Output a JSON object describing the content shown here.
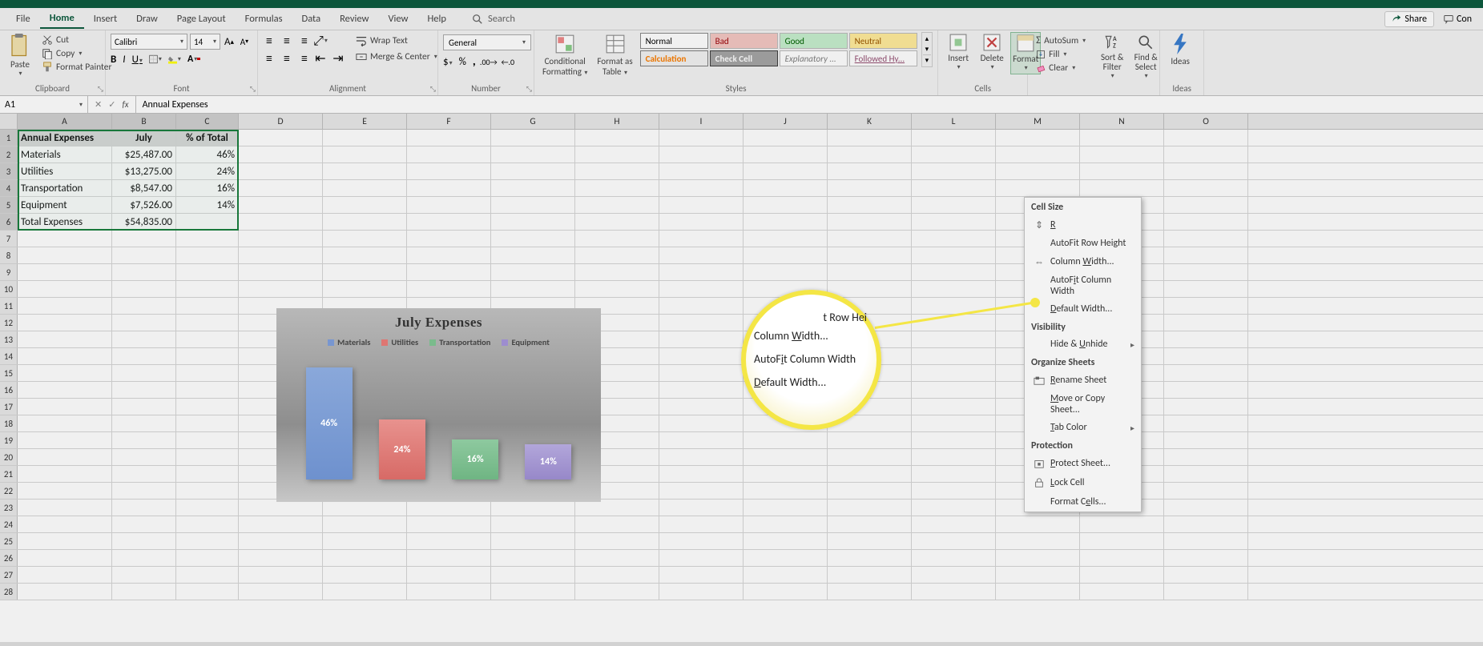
{
  "tabs": {
    "file": "File",
    "home": "Home",
    "insert": "Insert",
    "draw": "Draw",
    "pageLayout": "Page Layout",
    "formulas": "Formulas",
    "data": "Data",
    "review": "Review",
    "view": "View",
    "help": "Help",
    "search": "Search",
    "share": "Share",
    "comments": "Con"
  },
  "clipboard": {
    "paste": "Paste",
    "cut": "Cut",
    "copy": "Copy",
    "formatPainter": "Format Painter",
    "label": "Clipboard"
  },
  "font": {
    "name": "Calibri",
    "size": "14",
    "bold": "B",
    "italic": "I",
    "underline": "U",
    "label": "Font"
  },
  "alignment": {
    "wrap": "Wrap Text",
    "merge": "Merge & Center",
    "label": "Alignment"
  },
  "number": {
    "format": "General",
    "label": "Number"
  },
  "condfmt": {
    "label1": "Conditional",
    "label2": "Formatting",
    "tableLabel1": "Format as",
    "tableLabel2": "Table"
  },
  "styles": {
    "normal": "Normal",
    "bad": "Bad",
    "good": "Good",
    "neutral": "Neutral",
    "calc": "Calculation",
    "check": "Check Cell",
    "exp": "Explanatory ...",
    "follow": "Followed Hy...",
    "label": "Styles"
  },
  "cells": {
    "insert": "Insert",
    "delete": "Delete",
    "format": "Format",
    "label": "Cells"
  },
  "editing": {
    "autosum": "AutoSum",
    "fill": "Fill",
    "clear": "Clear",
    "sort": "Sort & Filter",
    "find": "Find & Select"
  },
  "ideas": {
    "label": "Ideas",
    "group": "Ideas"
  },
  "nameBox": "A1",
  "formula": "Annual Expenses",
  "columns": [
    "A",
    "B",
    "C",
    "D",
    "E",
    "F",
    "G",
    "H",
    "I",
    "J",
    "K",
    "L",
    "M",
    "N",
    "O"
  ],
  "data": {
    "headers": [
      "Annual Expenses",
      "July",
      "% of Total"
    ],
    "rows": [
      [
        "Materials",
        "$25,487.00",
        "46%"
      ],
      [
        "Utilities",
        "$13,275.00",
        "24%"
      ],
      [
        "Transportation",
        "$8,547.00",
        "16%"
      ],
      [
        "Equipment",
        "$7,526.00",
        "14%"
      ],
      [
        "Total Expenses",
        "$54,835.00",
        ""
      ]
    ]
  },
  "chart_data": {
    "type": "bar",
    "title": "July Expenses",
    "categories": [
      "Materials",
      "Utilities",
      "Transportation",
      "Equipment"
    ],
    "values": [
      46,
      24,
      16,
      14
    ],
    "value_labels": [
      "46%",
      "24%",
      "16%",
      "14%"
    ],
    "colors": [
      "#7896d0",
      "#de7672",
      "#7abb8c",
      "#9d8dcf"
    ],
    "legend_position": "top",
    "ylabel": "",
    "xlabel": ""
  },
  "zoom": {
    "rowHeight": "t Row Hei",
    "colWidth": "Column Width...",
    "autofit": "AutoFit Column Width",
    "defWidth": "Default Width..."
  },
  "formatMenu": {
    "cellSize": "Cell Size",
    "rowHeight": "Row Height...",
    "autofitRow": "AutoFit Row Height",
    "colWidth": "Column Width...",
    "autofitCol": "AutoFit Column Width",
    "defWidth": "Default Width...",
    "visibility": "Visibility",
    "hideUnhide": "Hide & Unhide",
    "organize": "Organize Sheets",
    "rename": "Rename Sheet",
    "moveCopy": "Move or Copy Sheet...",
    "tabColor": "Tab Color",
    "protection": "Protection",
    "protectSheet": "Protect Sheet...",
    "lockCell": "Lock Cell",
    "formatCells": "Format Cells..."
  }
}
